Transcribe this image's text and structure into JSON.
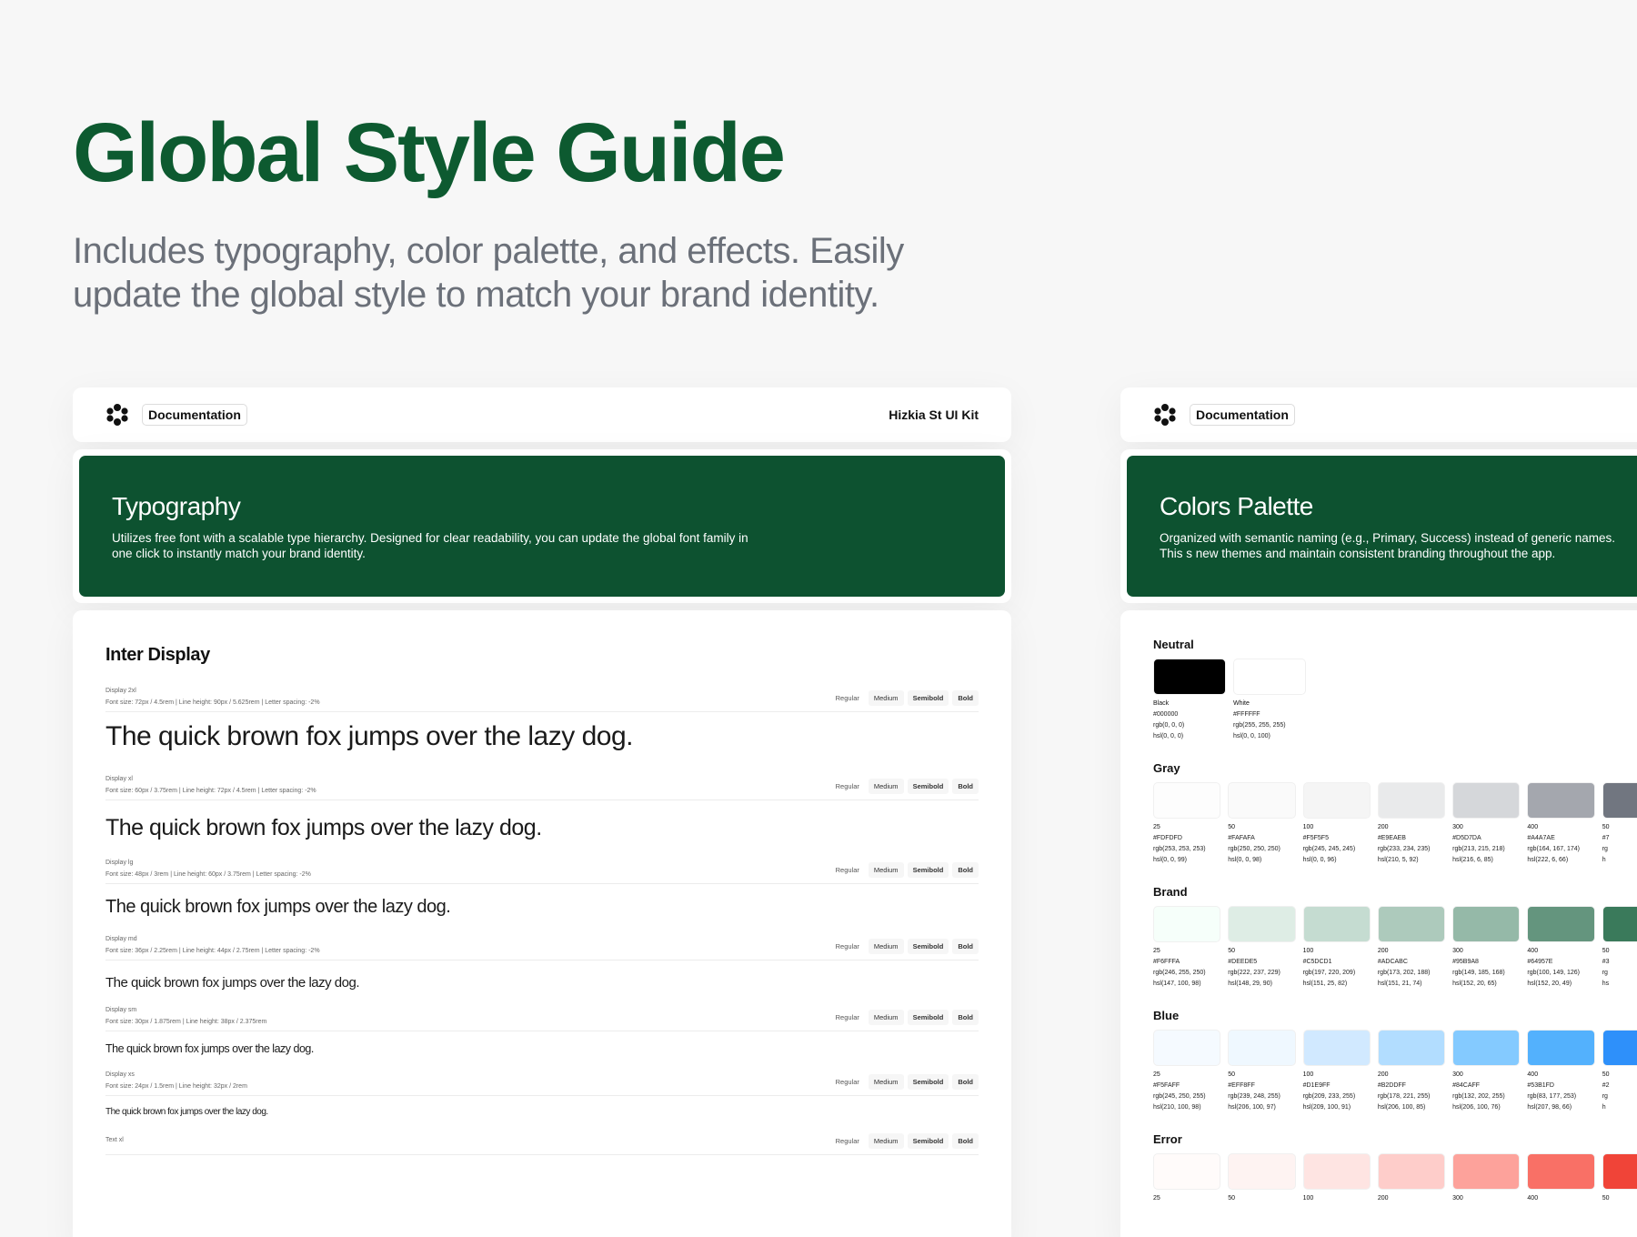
{
  "hero": {
    "title": "Global Style Guide",
    "subtitle": "Includes typography, color palette, and effects. Easily update the global style to match your brand identity."
  },
  "left_panel": {
    "doc_button": "Documentation",
    "kit_name": "Hizkia St UI Kit",
    "banner_title": "Typography",
    "banner_text": "Utilizes free font with a scalable type hierarchy. Designed for clear readability, you can update the global font family in one click to instantly match your brand identity.",
    "font_name": "Inter Display",
    "weights": [
      "Regular",
      "Medium",
      "Semibold",
      "Bold"
    ],
    "rows": [
      {
        "name": "Display 2xl",
        "spec": "Font size: 72px / 4.5rem | Line height: 90px / 5.625rem | Letter spacing: -2%",
        "sample": "The quick brown fox jumps over the lazy dog."
      },
      {
        "name": "Display xl",
        "spec": "Font size: 60px / 3.75rem | Line height: 72px / 4.5rem | Letter spacing: -2%",
        "sample": "The quick brown fox jumps over the lazy dog."
      },
      {
        "name": "Display lg",
        "spec": "Font size: 48px / 3rem | Line height: 60px / 3.75rem | Letter spacing: -2%",
        "sample": "The quick brown fox jumps over the lazy dog."
      },
      {
        "name": "Display md",
        "spec": "Font size: 36px / 2.25rem | Line height: 44px / 2.75rem | Letter spacing: -2%",
        "sample": "The quick brown fox jumps over the lazy dog."
      },
      {
        "name": "Display sm",
        "spec": "Font size: 30px / 1.875rem | Line height: 38px / 2.375rem",
        "sample": "The quick brown fox jumps over the lazy dog."
      },
      {
        "name": "Display xs",
        "spec": "Font size: 24px / 1.5rem | Line height: 32px / 2rem",
        "sample": "The quick brown fox jumps over the lazy dog."
      },
      {
        "name": "Text xl",
        "spec": "",
        "sample": ""
      }
    ]
  },
  "right_panel": {
    "doc_button": "Documentation",
    "banner_title": "Colors Palette",
    "banner_text": "Organized with semantic naming (e.g., Primary, Success) instead of generic names. This s new themes and maintain consistent branding throughout the app.",
    "groups": [
      {
        "title": "Neutral",
        "swatches": [
          {
            "name": "Black",
            "hex": "#000000",
            "rgb": "rgb(0, 0, 0)",
            "hsl": "hsl(0, 0, 0)",
            "color": "#000000"
          },
          {
            "name": "White",
            "hex": "#FFFFFF",
            "rgb": "rgb(255, 255, 255)",
            "hsl": "hsl(0, 0, 100)",
            "color": "#FFFFFF"
          }
        ]
      },
      {
        "title": "Gray",
        "swatches": [
          {
            "name": "25",
            "hex": "#FDFDFD",
            "rgb": "rgb(253, 253, 253)",
            "hsl": "hsl(0, 0, 99)",
            "color": "#FDFDFD"
          },
          {
            "name": "50",
            "hex": "#FAFAFA",
            "rgb": "rgb(250, 250, 250)",
            "hsl": "hsl(0, 0, 98)",
            "color": "#FAFAFA"
          },
          {
            "name": "100",
            "hex": "#F5F5F5",
            "rgb": "rgb(245, 245, 245)",
            "hsl": "hsl(0, 0, 96)",
            "color": "#F5F5F5"
          },
          {
            "name": "200",
            "hex": "#E9EAEB",
            "rgb": "rgb(233, 234, 235)",
            "hsl": "hsl(210, 5, 92)",
            "color": "#E9EAEB"
          },
          {
            "name": "300",
            "hex": "#D5D7DA",
            "rgb": "rgb(213, 215, 218)",
            "hsl": "hsl(216, 6, 85)",
            "color": "#D5D7DA"
          },
          {
            "name": "400",
            "hex": "#A4A7AE",
            "rgb": "rgb(164, 167, 174)",
            "hsl": "hsl(222, 6, 66)",
            "color": "#A4A7AE"
          },
          {
            "name": "50",
            "hex": "#7",
            "rgb": "rg",
            "hsl": "h",
            "color": "#717680"
          }
        ]
      },
      {
        "title": "Brand",
        "swatches": [
          {
            "name": "25",
            "hex": "#F6FFFA",
            "rgb": "rgb(246, 255, 250)",
            "hsl": "hsl(147, 100, 98)",
            "color": "#F6FFFA"
          },
          {
            "name": "50",
            "hex": "#DEEDE5",
            "rgb": "rgb(222, 237, 229)",
            "hsl": "hsl(148, 29, 90)",
            "color": "#DEEDE5"
          },
          {
            "name": "100",
            "hex": "#C5DCD1",
            "rgb": "rgb(197, 220, 209)",
            "hsl": "hsl(151, 25, 82)",
            "color": "#C5DCD1"
          },
          {
            "name": "200",
            "hex": "#ADCABC",
            "rgb": "rgb(173, 202, 188)",
            "hsl": "hsl(151, 21, 74)",
            "color": "#ADCABC"
          },
          {
            "name": "300",
            "hex": "#95B9A8",
            "rgb": "rgb(149, 185, 168)",
            "hsl": "hsl(152, 20, 65)",
            "color": "#95B9A8"
          },
          {
            "name": "400",
            "hex": "#64957E",
            "rgb": "rgb(100, 149, 126)",
            "hsl": "hsl(152, 20, 49)",
            "color": "#64957E"
          },
          {
            "name": "50",
            "hex": "#3",
            "rgb": "rg",
            "hsl": "hs",
            "color": "#3A7A5B"
          }
        ]
      },
      {
        "title": "Blue",
        "swatches": [
          {
            "name": "25",
            "hex": "#F5FAFF",
            "rgb": "rgb(245, 250, 255)",
            "hsl": "hsl(210, 100, 98)",
            "color": "#F5FAFF"
          },
          {
            "name": "50",
            "hex": "#EFF8FF",
            "rgb": "rgb(239, 248, 255)",
            "hsl": "hsl(206, 100, 97)",
            "color": "#EFF8FF"
          },
          {
            "name": "100",
            "hex": "#D1E9FF",
            "rgb": "rgb(209, 233, 255)",
            "hsl": "hsl(209, 100, 91)",
            "color": "#D1E9FF"
          },
          {
            "name": "200",
            "hex": "#B2DDFF",
            "rgb": "rgb(178, 221, 255)",
            "hsl": "hsl(206, 100, 85)",
            "color": "#B2DDFF"
          },
          {
            "name": "300",
            "hex": "#84CAFF",
            "rgb": "rgb(132, 202, 255)",
            "hsl": "hsl(206, 100, 76)",
            "color": "#84CAFF"
          },
          {
            "name": "400",
            "hex": "#53B1FD",
            "rgb": "rgb(83, 177, 253)",
            "hsl": "hsl(207, 98, 66)",
            "color": "#53B1FD"
          },
          {
            "name": "50",
            "hex": "#2",
            "rgb": "rg",
            "hsl": "h",
            "color": "#2E90FA"
          }
        ]
      },
      {
        "title": "Error",
        "swatches": [
          {
            "name": "25",
            "hex": "",
            "rgb": "",
            "hsl": "",
            "color": "#FFFBFA"
          },
          {
            "name": "50",
            "hex": "",
            "rgb": "",
            "hsl": "",
            "color": "#FEF3F2"
          },
          {
            "name": "100",
            "hex": "",
            "rgb": "",
            "hsl": "",
            "color": "#FEE4E2"
          },
          {
            "name": "200",
            "hex": "",
            "rgb": "",
            "hsl": "",
            "color": "#FECDCA"
          },
          {
            "name": "300",
            "hex": "",
            "rgb": "",
            "hsl": "",
            "color": "#FDA29B"
          },
          {
            "name": "400",
            "hex": "",
            "rgb": "",
            "hsl": "",
            "color": "#F97066"
          },
          {
            "name": "50",
            "hex": "",
            "rgb": "",
            "hsl": "",
            "color": "#F04438"
          }
        ]
      }
    ]
  },
  "colors": {
    "brand_green": "#0D5230",
    "hero_title": "#0D5A30",
    "subtitle_gray": "#6B7079"
  }
}
